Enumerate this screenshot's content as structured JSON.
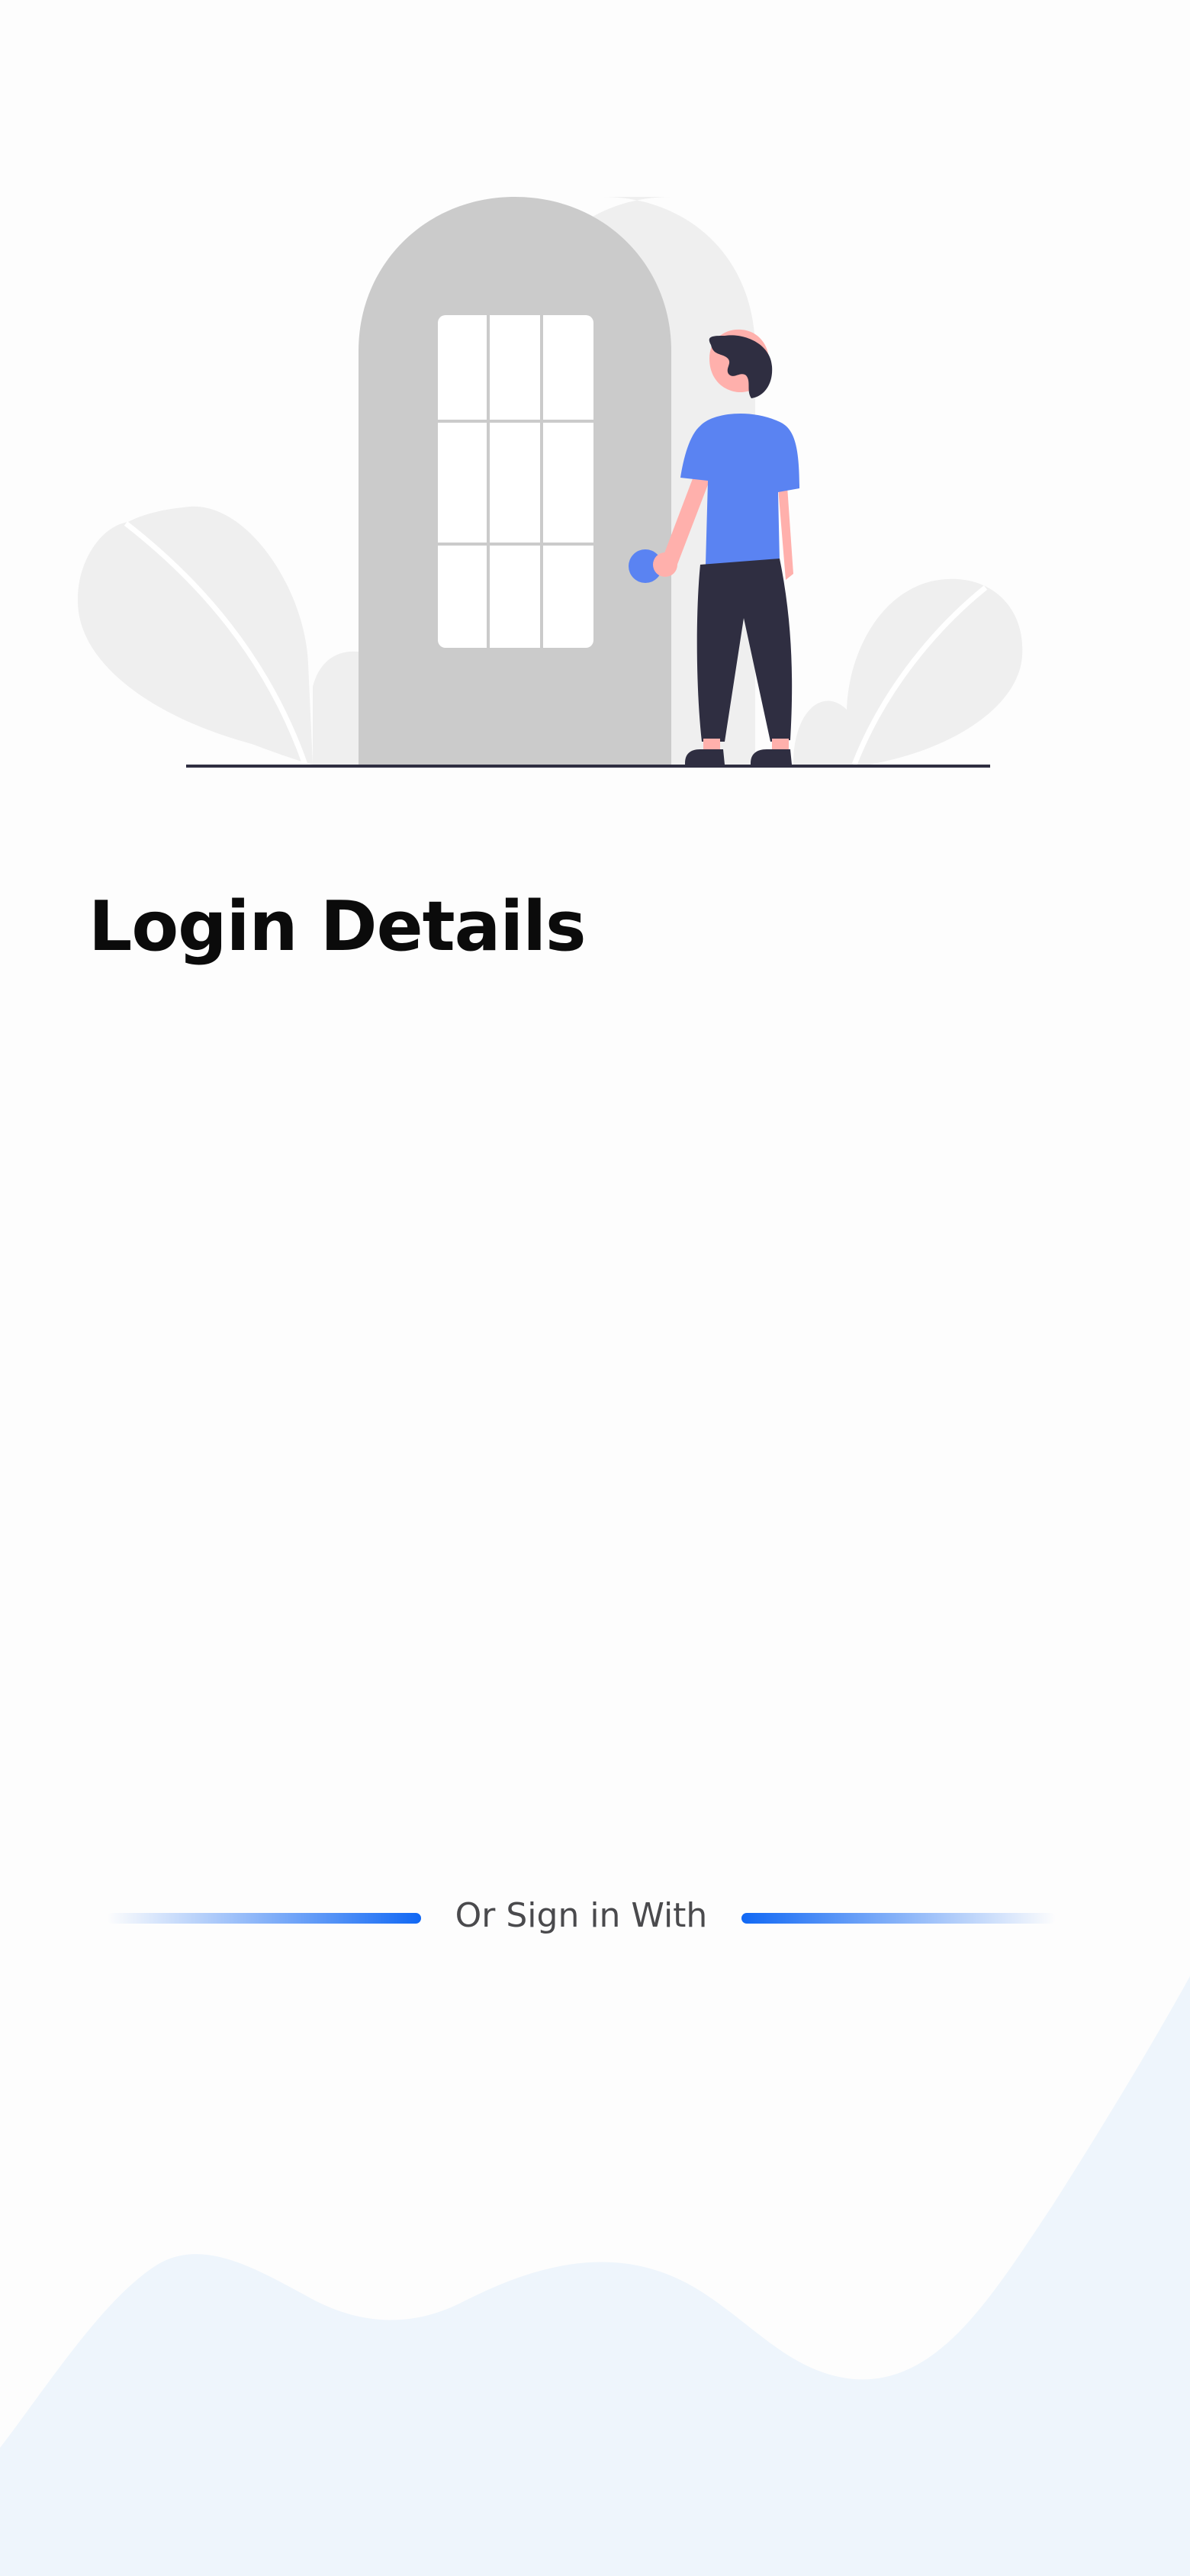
{
  "page": {
    "title": "Login Details"
  },
  "divider": {
    "label": "Or Sign in With"
  },
  "colors": {
    "accent": "#1168f4",
    "illustration_blue": "#5a83f2",
    "illustration_dark": "#2f2e41",
    "door_gray": "#cbcbcb",
    "wave_fill": "#eef5fc"
  },
  "illustration": {
    "icon": "person-at-door-illustration"
  }
}
